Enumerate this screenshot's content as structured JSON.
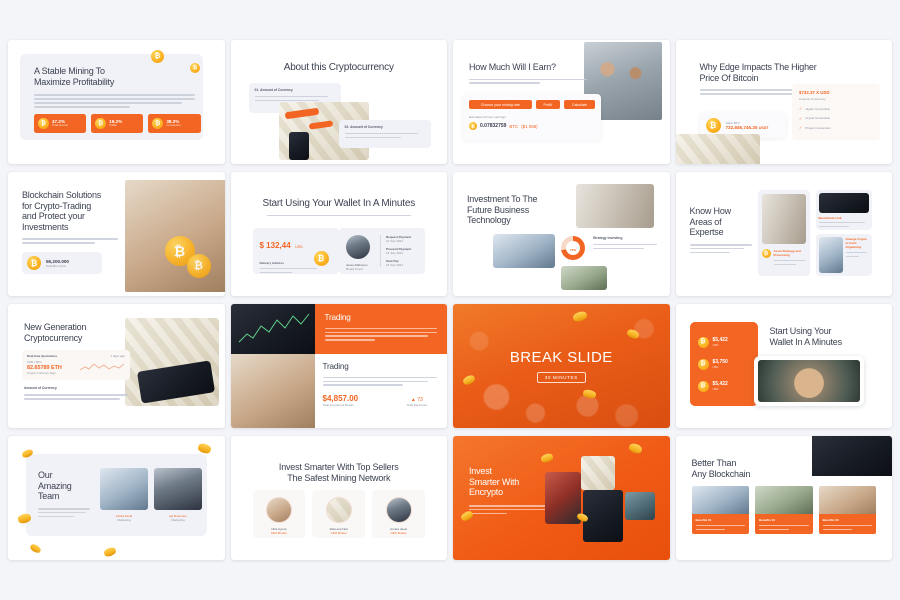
{
  "meta": {
    "background": "#f4f5f9",
    "accent": "#f26522",
    "slide_bg": "#ffffff"
  },
  "slides": [
    {
      "id": "stable-mining",
      "title_l1": "A Stable Mining To",
      "title_l2": "Maximize Profitability",
      "stats": [
        {
          "value": "47.2%",
          "label": "Total Income",
          "icon": "bitcoin-coin-icon"
        },
        {
          "value": "19.2%",
          "label": "Traffic",
          "icon": "bitcoin-coin-icon"
        },
        {
          "value": "38.2%",
          "label": "Conversion",
          "icon": "bitcoin-coin-icon"
        }
      ]
    },
    {
      "id": "about-cryptocurrency",
      "title": "About this Cryptocurrency",
      "cards": [
        {
          "heading": "01. Amount of Currency"
        },
        {
          "heading": "02. Amount of Currency"
        }
      ]
    },
    {
      "id": "how-much-earn",
      "title": "How Much Will I Earn?",
      "buttons": [
        "Choose your mining rate",
        "Profit",
        "Calculate"
      ],
      "result_label": "Estimated 24 hour earnings",
      "result_amount": "0.07832759",
      "result_unit": "BTC",
      "result_fiat": "($1 068)"
    },
    {
      "id": "why-edge-impacts",
      "title_l1": "Why Edge Impacts The Higher",
      "title_l2": "Price Of Bitcoin",
      "price_card": {
        "label": "Value BTC",
        "amount": "732,846,746.20",
        "unit": "USDT"
      },
      "side_card": {
        "amount": "$732.37 X USD",
        "label": "Amount of Currency",
        "items": [
          "Higher Conversion",
          "Crypto Conversion",
          "Project Conversion"
        ]
      }
    },
    {
      "id": "blockchain-solutions",
      "title_l1": "Blockchain Solutions",
      "title_l2": "for Crypto-Trading",
      "title_l3": "and Protect your",
      "title_l4": "Investments",
      "price_card": {
        "amount": "56,200.000",
        "label": "Total Btc Coins",
        "icon": "bitcoin-coin-icon"
      }
    },
    {
      "id": "start-using-wallet",
      "title": "Start Using Your Wallet In A Minutes",
      "price": "$ 132,44",
      "price_unit": "USD",
      "price_label": "Delivery Address",
      "person_name": "Jesse Rathnoon",
      "person_role": "Broad Invest",
      "timeline": [
        {
          "label": "Request Payment",
          "date": "10 July 2021"
        },
        {
          "label": "Proceed Payment",
          "date": "14 July 2021"
        },
        {
          "label": "Sent Pay",
          "date": "18 July 2021"
        }
      ]
    },
    {
      "id": "investment-future",
      "title_l1": "Investment To The",
      "title_l2": "Future Business",
      "title_l3": "Technology",
      "donut_value": "73%",
      "donut_label": "Strategy Investing"
    },
    {
      "id": "know-how-areas",
      "title_l1": "Know How",
      "title_l2": "Areas of",
      "title_l3": "Expertse",
      "cards": [
        {
          "heading": "Asset Strategy and Processing"
        },
        {
          "heading": "Blockchain Link"
        },
        {
          "heading": "Change Crypto to Cash Organizing"
        }
      ]
    },
    {
      "id": "new-generation",
      "title_l1": "New Generation",
      "title_l2": "Cryptocurrency",
      "quote_label": "Real time Quotations",
      "quote_time": "7 days ago",
      "pair": "USD / BTC",
      "quote_value": "82.65789 ETH",
      "quote_sub": "Crypto Currency Sign",
      "section_label": "Amount of Currency"
    },
    {
      "id": "trading",
      "banner_title": "Trading",
      "body_title": "Trading",
      "amount": "$4,857.00",
      "amount_label": "Total Investment Return",
      "delta": "73",
      "delta_label": "Total Expenses"
    },
    {
      "id": "break-slide",
      "title": "BREAK SLIDE",
      "badge": "30 MINUTES"
    },
    {
      "id": "wallet-minutes",
      "title_l1": "Start Using Your",
      "title_l2": "Wallet In A Minutes",
      "rows": [
        {
          "amount": "$5,422",
          "unit": "USD",
          "icon": "bitcoin-coin-icon"
        },
        {
          "amount": "$3,750",
          "unit": "USD",
          "icon": "bitcoin-coin-icon"
        },
        {
          "amount": "$5,422",
          "unit": "USD",
          "icon": "bitcoin-coin-icon"
        }
      ]
    },
    {
      "id": "amazing-team",
      "title_l1": "Our",
      "title_l2": "Amazing",
      "title_l3": "Team",
      "members": [
        {
          "name": "Azelia Facia",
          "role": "Marketing"
        },
        {
          "name": "Ayl Rosemoo",
          "role": "Marketing"
        }
      ]
    },
    {
      "id": "invest-smarter-sellers",
      "title_l1": "Invest Smarter With Top Sellers",
      "title_l2": "The Safest Mining Network",
      "sellers": [
        {
          "name": "Niza Ayuna",
          "role": "CEO Broker"
        },
        {
          "name": "Rebecca Nett",
          "role": "CEO Broker"
        },
        {
          "name": "Arnara deesi",
          "role": "CEO Broker"
        }
      ]
    },
    {
      "id": "invest-smarter-encrypto",
      "title_l1": "Invest",
      "title_l2": "Smarter With",
      "title_l3": "Encrypto"
    },
    {
      "id": "better-than-blockchain",
      "title_l1": "Better Than",
      "title_l2": "Any Blockchain",
      "benefits": [
        {
          "heading": "Benefits 01"
        },
        {
          "heading": "Benefits 02"
        },
        {
          "heading": "Benefits 03"
        }
      ]
    }
  ]
}
